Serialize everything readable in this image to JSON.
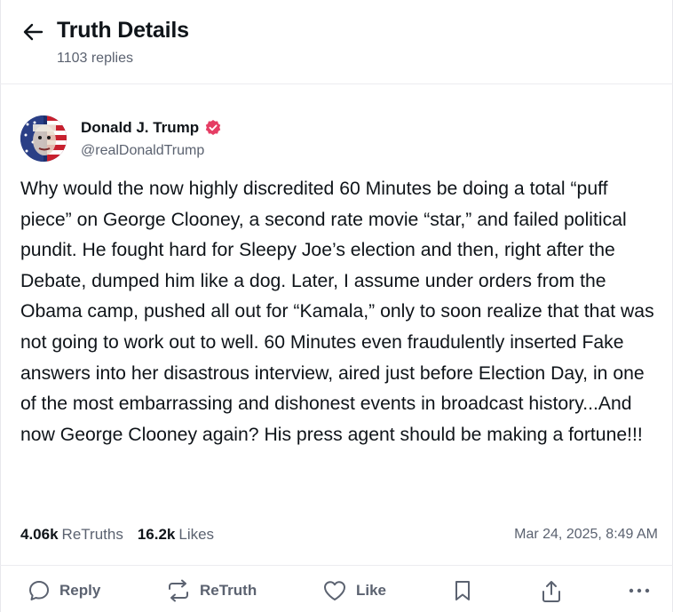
{
  "header": {
    "title": "Truth Details",
    "replies": "1103 replies"
  },
  "post": {
    "author_name": "Donald J. Trump",
    "handle": "@realDonaldTrump",
    "text": "Why would the now highly discredited 60 Minutes be doing a total “puff piece” on George Clooney, a second rate movie “star,” and failed political pundit. He fought hard for Sleepy Joe’s election and then, right after the Debate, dumped him like a dog. Later, I assume under orders from the Obama camp, pushed all out for “Kamala,” only to soon realize that that was not going to work out to well. 60 Minutes even fraudulently inserted Fake answers into her disastrous interview, aired just before Election Day, in one of the most embarrassing and dishonest events in broadcast history...And now George Clooney again? His press agent should be making a fortune!!!",
    "retruths_count": "4.06k",
    "retruths_label": "ReTruths",
    "likes_count": "16.2k",
    "likes_label": "Likes",
    "timestamp": "Mar 24, 2025, 8:49 AM"
  },
  "actions": {
    "reply": "Reply",
    "retruth": "ReTruth",
    "like": "Like"
  },
  "icons": {
    "back": "arrow-left-icon",
    "verified": "verified-badge-icon",
    "reply": "speech-bubble-icon",
    "retruth": "repost-arrows-icon",
    "like": "heart-icon",
    "bookmark": "bookmark-icon",
    "share": "share-icon",
    "more": "more-dots-icon"
  },
  "colors": {
    "accent": "#e53d64",
    "text": "#0f1419",
    "muted": "#5b6270"
  }
}
